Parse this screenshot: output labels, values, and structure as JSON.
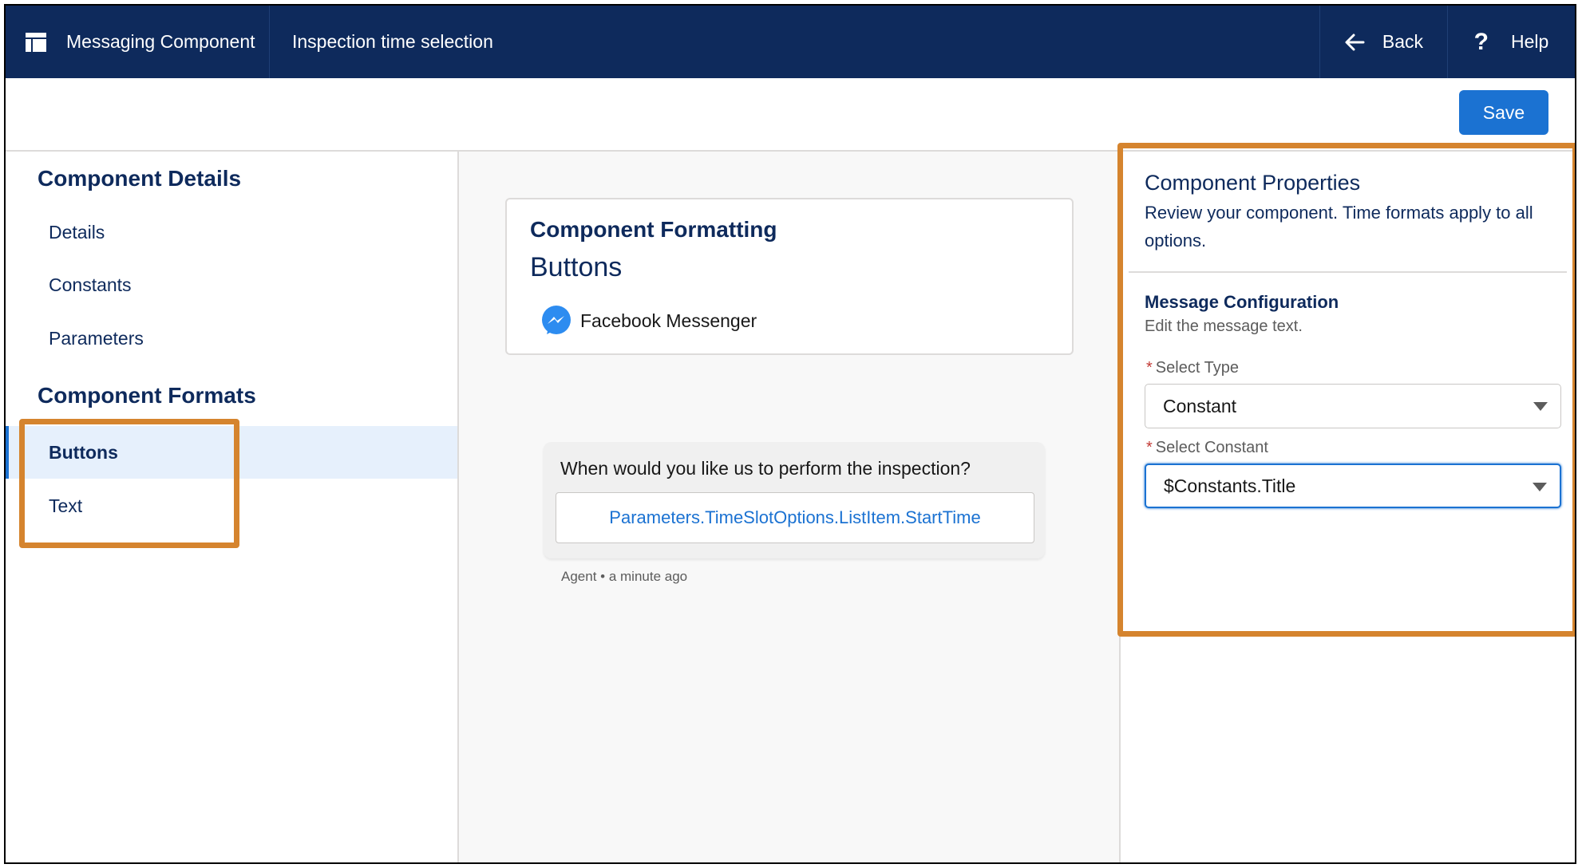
{
  "header": {
    "app_name": "Messaging Component",
    "app_icon": "app-window-icon",
    "page_title": "Inspection time selection",
    "back_label": "Back",
    "back_icon": "arrow-left-icon",
    "help_label": "Help",
    "help_icon": "question-icon",
    "background_color": "#0e2a5c"
  },
  "toolbar": {
    "save_label": "Save",
    "save_color": "#1b72d2"
  },
  "sidebar": {
    "details_heading": "Component Details",
    "details_items": [
      {
        "label": "Details"
      },
      {
        "label": "Constants"
      },
      {
        "label": "Parameters"
      }
    ],
    "formats_heading": "Component Formats",
    "format_items": [
      {
        "label": "Buttons",
        "active": true
      },
      {
        "label": "Text",
        "active": false
      }
    ]
  },
  "preview": {
    "card_title": "Component Formatting",
    "card_subtitle": "Buttons",
    "channel_icon": "messenger-icon",
    "channel_name": "Facebook Messenger",
    "message_question": "When would you like us to perform the inspection?",
    "message_button": "Parameters.TimeSlotOptions.ListItem.StartTime",
    "meta": "Agent • a minute ago"
  },
  "properties": {
    "title": "Component Properties",
    "description": "Review your component. Time formats apply to all options.",
    "section_title": "Message Configuration",
    "section_desc": "Edit the message text.",
    "select_type_label": "Select Type",
    "select_type_value": "Constant",
    "select_constant_label": "Select Constant",
    "select_constant_value": "$Constants.Title",
    "required_marker": "*"
  },
  "callout_color": "#d5842e"
}
